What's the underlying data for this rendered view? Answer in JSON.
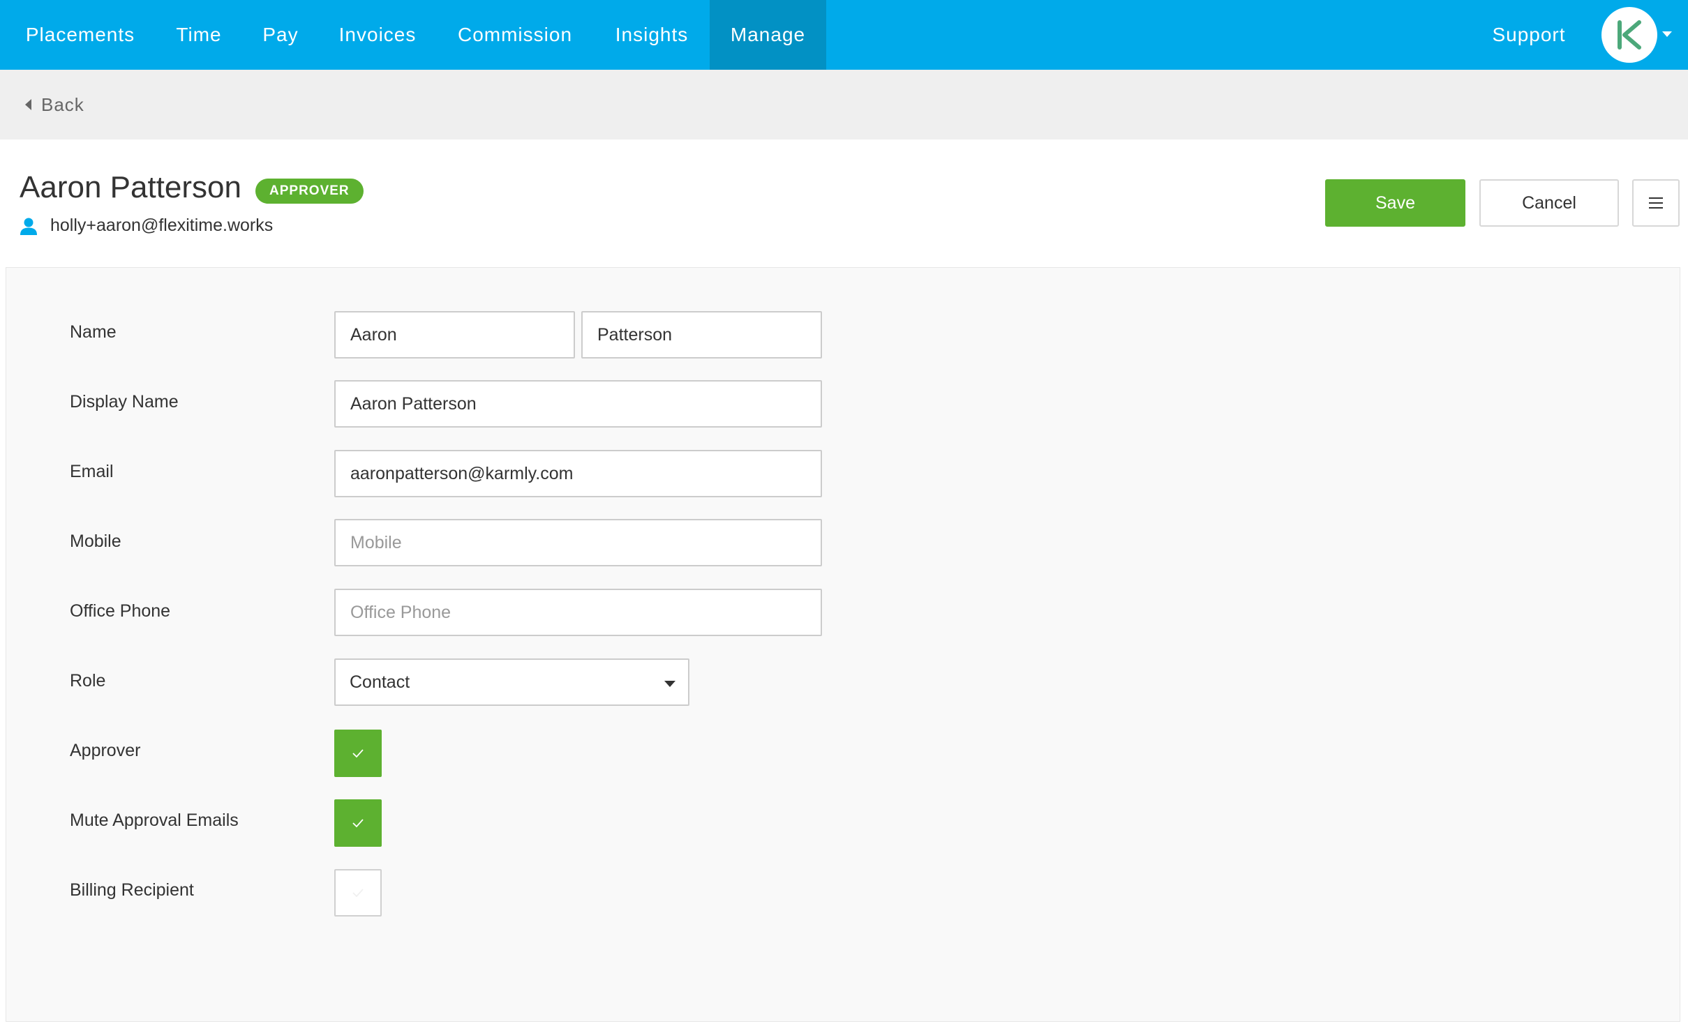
{
  "nav": {
    "items": [
      {
        "label": "Placements"
      },
      {
        "label": "Time"
      },
      {
        "label": "Pay"
      },
      {
        "label": "Invoices"
      },
      {
        "label": "Commission"
      },
      {
        "label": "Insights"
      },
      {
        "label": "Manage",
        "active": true
      }
    ],
    "support_label": "Support",
    "avatar_icon": "karmly-logo-icon"
  },
  "back": {
    "label": "Back"
  },
  "header": {
    "name": "Aaron Patterson",
    "badge": "APPROVER",
    "login_email": "holly+aaron@flexitime.works",
    "save_label": "Save",
    "cancel_label": "Cancel",
    "menu_icon": "hamburger-menu-icon"
  },
  "form": {
    "name_label": "Name",
    "first_name": "Aaron",
    "last_name": "Patterson",
    "display_name_label": "Display Name",
    "display_name": "Aaron Patterson",
    "email_label": "Email",
    "email": "aaronpatterson@karmly.com",
    "mobile_label": "Mobile",
    "mobile_value": "",
    "mobile_placeholder": "Mobile",
    "office_phone_label": "Office Phone",
    "office_phone_value": "",
    "office_phone_placeholder": "Office Phone",
    "role_label": "Role",
    "role_value": "Contact",
    "approver_label": "Approver",
    "approver_checked": true,
    "mute_label": "Mute Approval Emails",
    "mute_checked": true,
    "billing_label": "Billing Recipient",
    "billing_checked": false
  },
  "colors": {
    "nav_bg": "#00aaea",
    "nav_active": "#0291c4",
    "accent_green": "#5db130",
    "logo_green": "#4ca87a"
  }
}
